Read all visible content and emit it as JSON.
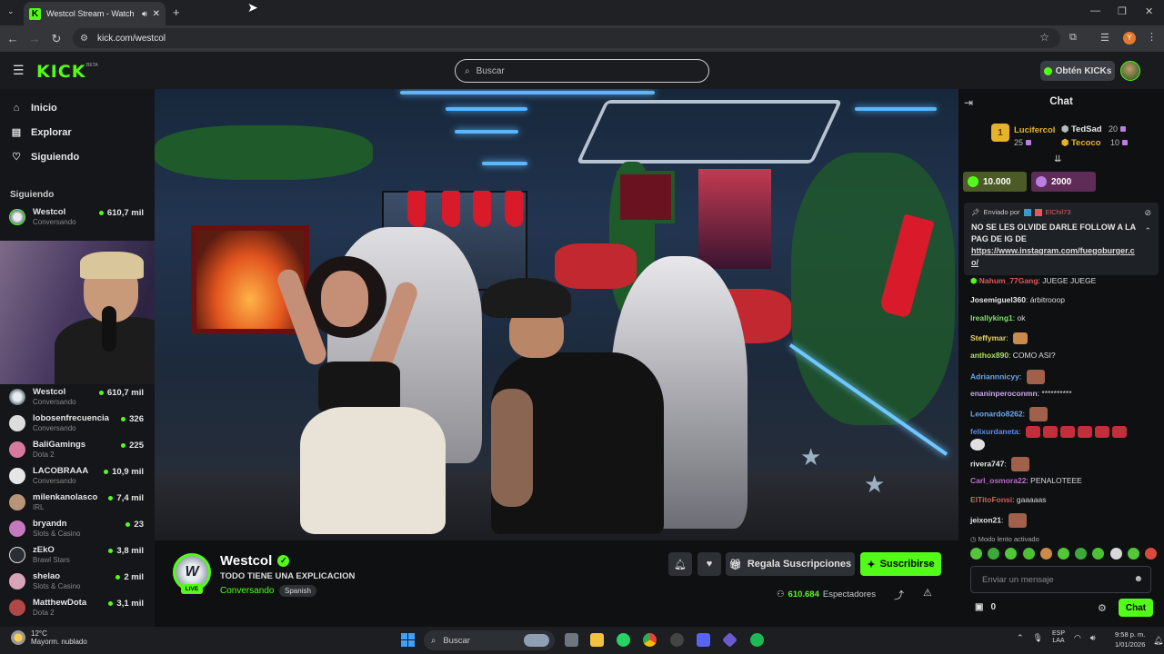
{
  "browser": {
    "tab_title": "Westcol Stream - Watch Li",
    "tab_favicon": "K",
    "url": "kick.com/westcol",
    "profile_initial": "Y"
  },
  "header": {
    "logo": "KICK",
    "beta": "BETA",
    "search_placeholder": "Buscar",
    "get_kicks": "Obtén KICKs"
  },
  "sidebar": {
    "nav": [
      {
        "label": "Inicio",
        "icon": "home-icon"
      },
      {
        "label": "Explorar",
        "icon": "explore-icon"
      },
      {
        "label": "Siguiendo",
        "icon": "heart-icon"
      }
    ],
    "following_title": "Siguiendo",
    "following": [
      {
        "name": "Westcol",
        "category": "Conversando",
        "viewers": "610,7 mil"
      }
    ],
    "recommended": [
      {
        "name": "Westcol",
        "category": "Conversando",
        "viewers": "610,7 mil"
      },
      {
        "name": "lobosenfrecuencia",
        "category": "Conversando",
        "viewers": "326"
      },
      {
        "name": "BaliGamings",
        "category": "Dota 2",
        "viewers": "225"
      },
      {
        "name": "LACOBRAAA",
        "category": "Conversando",
        "viewers": "10,9 mil"
      },
      {
        "name": "milenkanolasco",
        "category": "IRL",
        "viewers": "7,4 mil"
      },
      {
        "name": "bryandn",
        "category": "Slots & Casino",
        "viewers": "23"
      },
      {
        "name": "zEkO",
        "category": "Brawl Stars",
        "viewers": "3,8 mil"
      },
      {
        "name": "shelao",
        "category": "Slots & Casino",
        "viewers": "2 mil"
      },
      {
        "name": "MatthewDota",
        "category": "Dota 2",
        "viewers": "3,1 mil"
      }
    ]
  },
  "stream": {
    "channel": "Westcol",
    "avatar_initials": "W",
    "live": "LIVE",
    "title": "TODO TIENE UNA EXPLICACION",
    "category": "Conversando",
    "language": "Spanish",
    "gift_label": "Regala Suscripciones",
    "subscribe_label": "Suscribirse",
    "viewers": "610.684",
    "viewers_label": "Espectadores"
  },
  "chat": {
    "title": "Chat",
    "leaderboard": [
      {
        "rank": "1",
        "name": "Lucifercol",
        "value": "25",
        "color": "#e4b32b"
      },
      {
        "name": "TedSad",
        "value": "20",
        "color": "#e8e8e8"
      },
      {
        "name": "Tecoco",
        "value": "10",
        "color": "#e4b32b"
      }
    ],
    "kicks_chips": [
      {
        "value": "10.000",
        "color": "#5d6b2e"
      },
      {
        "value": "2000",
        "color": "#6b2e63"
      }
    ],
    "pinned": {
      "sent_by": "Enviado por",
      "pinned_user": "ElChil73",
      "text": "NO SE LES OLVIDE DARLE FOLLOW A LA PAG DE IG DE",
      "link": "https://www.instagram.com/fuegoburger.co/"
    },
    "messages": [
      {
        "user": "Nahum_77Gang",
        "text": "JUEGE JUEGE",
        "color": "#e05a5a"
      },
      {
        "user": "Josemiguel360",
        "text": "árbitrooop",
        "color": "#e8e8e8"
      },
      {
        "user": "Ireallyking1",
        "text": "ok",
        "color": "#7ee06b"
      },
      {
        "user": "Steffymar",
        "text": "",
        "color": "#e7d65a"
      },
      {
        "user": "anthox890",
        "text": "COMO ASI?",
        "color": "#a8e05a"
      },
      {
        "user": "Adriannnicyy",
        "text": "",
        "color": "#6ba8f0"
      },
      {
        "user": "enaninperoconmn",
        "text": "**********",
        "color": "#c9a8e8"
      },
      {
        "user": "Leonardo8262",
        "text": "",
        "color": "#6ba8f0"
      },
      {
        "user": "felixurdaneta",
        "text": "",
        "color": "#5a8cf0"
      },
      {
        "user": "rivera747",
        "text": "",
        "color": "#e8e8e8"
      },
      {
        "user": "Carl_osmora22",
        "text": "PENALOTEEE",
        "color": "#c06ad0"
      },
      {
        "user": "ElTitoFonsi",
        "text": "gaaaaas",
        "color": "#e05a5a"
      },
      {
        "user": "jeixon21",
        "text": "",
        "color": "#e8e8e8"
      }
    ],
    "slow_mode": "Modo lento activado",
    "input_placeholder": "Enviar un mensaje",
    "points": "0",
    "chat_button": "Chat"
  },
  "taskbar": {
    "temperature": "12°C",
    "weather": "Mayorm. nublado",
    "search_placeholder": "Buscar",
    "lang_line1": "ESP",
    "lang_line2": "LAA",
    "time": "9:58 p. m.",
    "date": "1/01/2026"
  }
}
